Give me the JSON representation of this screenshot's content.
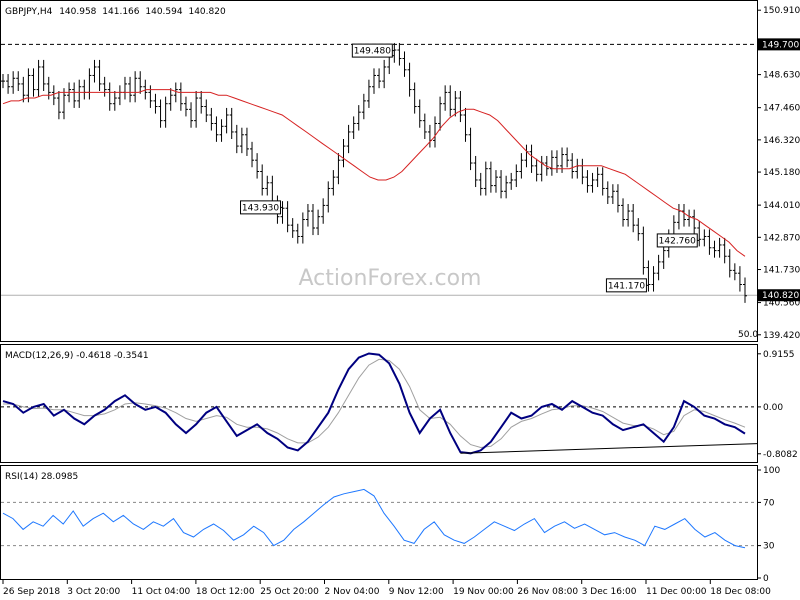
{
  "header": {
    "symbol": "GBPJPY,H4",
    "open": "140.958",
    "high": "141.166",
    "low": "140.594",
    "close": "140.820"
  },
  "watermark": "ActionForex.com",
  "colors": {
    "price_bars": "#000000",
    "ma_line": "#d62222",
    "macd_line": "#000080",
    "signal_line": "#a0a0a0",
    "rsi_line": "#1e78ff",
    "price_label_bg": "#000000",
    "price_label_text": "#ffffff"
  },
  "chart_data": [
    {
      "type": "line",
      "title": "GBPJPY,H4",
      "y_ticks": [
        "150.910",
        "149.700",
        "148.630",
        "147.460",
        "146.320",
        "145.180",
        "144.010",
        "142.870",
        "141.730",
        "140.560",
        "139.420"
      ],
      "ylim": [
        139.2,
        151.2
      ],
      "x_tick_labels": [
        "26 Sep 2018",
        "3 Oct 20:00",
        "11 Oct 04:00",
        "18 Oct 12:00",
        "25 Oct 20:00",
        "2 Nov 04:00",
        "9 Nov 12:00",
        "19 Nov 00:00",
        "26 Nov 08:00",
        "3 Dec 16:00",
        "11 Dec 00:00",
        "18 Dec 08:00"
      ],
      "horizontal_line": {
        "value": 149.7,
        "label": "149.700",
        "style": "dashed"
      },
      "current_price": {
        "value": 140.82,
        "label": "140.820"
      },
      "annotations": [
        {
          "label": "149.480",
          "value": 149.48
        },
        {
          "label": "142.760",
          "value": 142.76
        },
        {
          "label": "143.930",
          "value": 143.93
        },
        {
          "label": "141.170",
          "value": 141.17
        }
      ],
      "ma_label": "50.0",
      "close_path": [
        148.4,
        148.2,
        148.5,
        148.3,
        147.9,
        148.6,
        148.1,
        148.9,
        148.3,
        148.0,
        147.8,
        147.3,
        147.9,
        148.1,
        147.7,
        148.2,
        148.0,
        148.6,
        148.9,
        148.3,
        148.1,
        147.6,
        147.8,
        148.0,
        148.3,
        147.9,
        148.5,
        148.2,
        148.0,
        147.7,
        147.5,
        147.0,
        147.6,
        147.9,
        148.1,
        147.6,
        147.4,
        147.0,
        147.8,
        147.5,
        147.2,
        146.9,
        146.5,
        146.8,
        147.2,
        146.6,
        146.1,
        146.5,
        146.0,
        145.6,
        145.2,
        144.6,
        144.8,
        144.1,
        143.6,
        143.9,
        143.3,
        143.1,
        142.9,
        143.5,
        143.8,
        143.2,
        143.6,
        144.0,
        144.6,
        145.0,
        145.6,
        146.1,
        146.6,
        146.9,
        147.3,
        147.7,
        148.2,
        148.6,
        148.4,
        148.9,
        149.3,
        149.5,
        149.2,
        148.8,
        148.1,
        147.5,
        147.0,
        146.6,
        146.3,
        146.9,
        147.6,
        148.0,
        147.4,
        147.8,
        147.2,
        146.5,
        145.5,
        144.9,
        144.6,
        145.3,
        144.7,
        145.0,
        144.5,
        144.8,
        144.9,
        145.2,
        145.6,
        145.9,
        145.4,
        145.1,
        145.5,
        145.3,
        145.7,
        145.4,
        145.8,
        145.6,
        145.2,
        145.4,
        145.0,
        144.7,
        144.9,
        145.1,
        144.6,
        144.3,
        144.5,
        144.0,
        143.5,
        143.8,
        143.3,
        143.0,
        141.8,
        141.2,
        141.6,
        142.0,
        142.4,
        142.9,
        143.4,
        143.8,
        143.5,
        143.6,
        143.2,
        142.8,
        142.9,
        142.5,
        142.4,
        142.6,
        142.2,
        141.7,
        141.6,
        141.2,
        140.8
      ],
      "ma_path": [
        147.6,
        147.7,
        147.7,
        147.8,
        147.8,
        147.9,
        147.9,
        148.0,
        148.0,
        148.0,
        148.0,
        148.0,
        148.0,
        148.0,
        148.0,
        148.0,
        148.0,
        148.0,
        148.1,
        148.1,
        148.1,
        148.1,
        148.0,
        148.0,
        148.0,
        148.0,
        148.0,
        147.9,
        147.9,
        147.8,
        147.7,
        147.6,
        147.5,
        147.4,
        147.3,
        147.2,
        147.0,
        146.8,
        146.6,
        146.4,
        146.2,
        146.0,
        145.8,
        145.6,
        145.4,
        145.2,
        145.0,
        144.9,
        144.9,
        145.0,
        145.2,
        145.5,
        145.8,
        146.1,
        146.4,
        146.8,
        147.1,
        147.3,
        147.4,
        147.4,
        147.3,
        147.2,
        147.0,
        146.7,
        146.4,
        146.1,
        145.8,
        145.6,
        145.4,
        145.3,
        145.3,
        145.3,
        145.4,
        145.4,
        145.4,
        145.4,
        145.3,
        145.2,
        145.1,
        144.9,
        144.7,
        144.5,
        144.3,
        144.1,
        143.9,
        143.8,
        143.6,
        143.5,
        143.3,
        143.1,
        142.9,
        142.7,
        142.4,
        142.2
      ]
    },
    {
      "type": "line",
      "title": "MACD(12,26,9) -0.4618 -0.3541",
      "y_ticks": [
        "0.9155",
        "0.00",
        "-0.8082"
      ],
      "ylim": [
        -0.95,
        1.05
      ],
      "zero_line": true,
      "series": [
        {
          "name": "MACD",
          "values": [
            0.1,
            0.05,
            -0.1,
            0.0,
            0.05,
            -0.15,
            -0.05,
            -0.2,
            -0.3,
            -0.15,
            -0.05,
            0.1,
            0.2,
            0.05,
            -0.05,
            0.0,
            -0.1,
            -0.3,
            -0.45,
            -0.3,
            -0.1,
            0.0,
            -0.25,
            -0.5,
            -0.4,
            -0.3,
            -0.45,
            -0.55,
            -0.7,
            -0.75,
            -0.6,
            -0.35,
            -0.1,
            0.3,
            0.65,
            0.85,
            0.92,
            0.9,
            0.75,
            0.4,
            -0.1,
            -0.45,
            -0.2,
            -0.05,
            -0.45,
            -0.78,
            -0.8,
            -0.75,
            -0.6,
            -0.35,
            -0.1,
            -0.2,
            -0.15,
            0.0,
            0.05,
            -0.05,
            0.1,
            0.0,
            -0.1,
            -0.15,
            -0.3,
            -0.4,
            -0.35,
            -0.3,
            -0.45,
            -0.6,
            -0.35,
            0.1,
            0.0,
            -0.15,
            -0.2,
            -0.3,
            -0.35,
            -0.46
          ]
        },
        {
          "name": "Signal",
          "values": [
            0.05,
            0.05,
            0.0,
            -0.03,
            -0.02,
            -0.05,
            -0.05,
            -0.1,
            -0.15,
            -0.15,
            -0.12,
            -0.05,
            0.05,
            0.07,
            0.05,
            0.02,
            -0.02,
            -0.1,
            -0.2,
            -0.25,
            -0.2,
            -0.15,
            -0.18,
            -0.3,
            -0.35,
            -0.35,
            -0.38,
            -0.45,
            -0.55,
            -0.62,
            -0.62,
            -0.52,
            -0.35,
            -0.1,
            0.2,
            0.5,
            0.72,
            0.82,
            0.8,
            0.65,
            0.35,
            -0.05,
            -0.2,
            -0.18,
            -0.3,
            -0.5,
            -0.65,
            -0.7,
            -0.68,
            -0.55,
            -0.35,
            -0.25,
            -0.2,
            -0.12,
            -0.05,
            -0.03,
            0.02,
            0.02,
            -0.02,
            -0.08,
            -0.18,
            -0.28,
            -0.32,
            -0.32,
            -0.38,
            -0.48,
            -0.42,
            -0.15,
            -0.05,
            -0.08,
            -0.15,
            -0.22,
            -0.28,
            -0.35
          ]
        }
      ],
      "trendline": true
    },
    {
      "type": "line",
      "title": "RSI(14) 28.0985",
      "y_ticks": [
        "100",
        "70",
        "30",
        "0"
      ],
      "ylim": [
        0,
        100
      ],
      "guide_levels": [
        70,
        30
      ],
      "series": [
        {
          "name": "RSI(14)",
          "values": [
            60,
            55,
            45,
            52,
            48,
            58,
            50,
            62,
            48,
            55,
            60,
            52,
            58,
            50,
            45,
            52,
            48,
            55,
            42,
            38,
            45,
            50,
            44,
            35,
            40,
            48,
            42,
            30,
            35,
            45,
            52,
            60,
            68,
            75,
            78,
            80,
            82,
            76,
            60,
            48,
            35,
            32,
            45,
            52,
            40,
            35,
            32,
            38,
            45,
            52,
            48,
            44,
            50,
            55,
            42,
            48,
            52,
            46,
            50,
            45,
            40,
            42,
            38,
            35,
            30,
            48,
            45,
            50,
            55,
            45,
            38,
            42,
            35,
            30,
            28
          ]
        }
      ]
    }
  ]
}
